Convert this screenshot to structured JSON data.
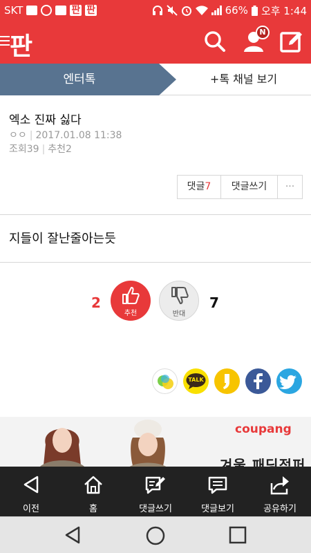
{
  "status_bar": {
    "carrier": "SKT",
    "battery": "66%",
    "time": "오후 1:44"
  },
  "header": {
    "logo": "판",
    "notification_badge": "N"
  },
  "tabs": {
    "active": "엔터톡",
    "channel": "+톡 채널 보기"
  },
  "post": {
    "title": "엑소 진짜 싫다",
    "author": "ㅇㅇ",
    "date": "2017.01.08 11:38",
    "views_label": "조회39",
    "recommend_label": "추천2",
    "body": "지들이 잘난줄아는듯"
  },
  "comments_bar": {
    "comments_label": "댓글",
    "comments_count": "7",
    "write_label": "댓글쓰기",
    "more_label": "···"
  },
  "votes": {
    "up_count": "2",
    "up_label": "추천",
    "down_count": "7",
    "down_label": "반대"
  },
  "share": {
    "kakaotalk_label": "TALK"
  },
  "ad": {
    "brand": "coupang",
    "text": "겨울 패딩점퍼"
  },
  "bottom_nav": {
    "prev": "이전",
    "home": "홈",
    "write_comment": "댓글쓰기",
    "view_comments": "댓글보기",
    "share": "공유하기"
  },
  "colors": {
    "brand_red": "#e8393a",
    "tab_active": "#587390",
    "bottom_nav_bg": "#222222"
  }
}
